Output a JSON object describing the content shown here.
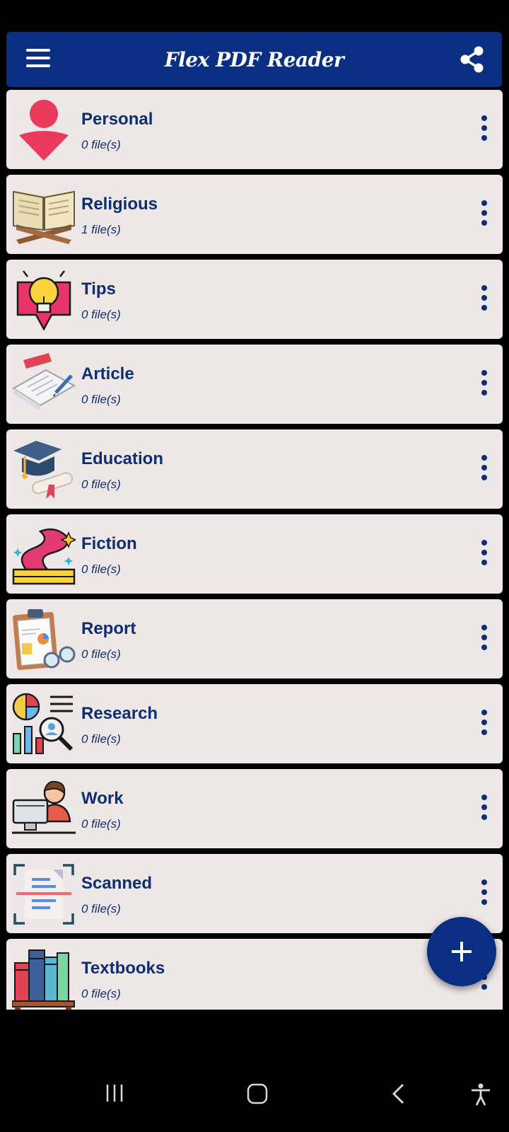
{
  "app": {
    "title": "Flex PDF Reader",
    "brand_color": "#0a2f82",
    "text_color": "#0d2e72",
    "card_color": "#ede7e7"
  },
  "header": {
    "menu_icon": "hamburger-menu-icon",
    "share_icon": "share-icon"
  },
  "categories": [
    {
      "name": "Personal",
      "count": "0 file(s)",
      "icon": "person-icon"
    },
    {
      "name": "Religious",
      "count": "1 file(s)",
      "icon": "open-book-on-stand-icon"
    },
    {
      "name": "Tips",
      "count": "0 file(s)",
      "icon": "lightbulb-icon"
    },
    {
      "name": "Article",
      "count": "0 file(s)",
      "icon": "article-paper-icon"
    },
    {
      "name": "Education",
      "count": "0 file(s)",
      "icon": "graduation-cap-icon"
    },
    {
      "name": "Fiction",
      "count": "0 file(s)",
      "icon": "magic-book-icon"
    },
    {
      "name": "Report",
      "count": "0 file(s)",
      "icon": "report-clipboard-icon"
    },
    {
      "name": "Research",
      "count": "0 file(s)",
      "icon": "research-chart-icon"
    },
    {
      "name": "Work",
      "count": "0 file(s)",
      "icon": "person-at-computer-icon"
    },
    {
      "name": "Scanned",
      "count": "0 file(s)",
      "icon": "scanned-document-icon"
    },
    {
      "name": "Textbooks",
      "count": "0 file(s)",
      "icon": "bookshelf-icon"
    }
  ],
  "fab": {
    "icon": "plus-icon"
  },
  "navbar": {
    "recents_icon": "recents-icon",
    "home_icon": "home-icon",
    "back_icon": "back-icon",
    "accessibility_icon": "accessibility-icon"
  }
}
